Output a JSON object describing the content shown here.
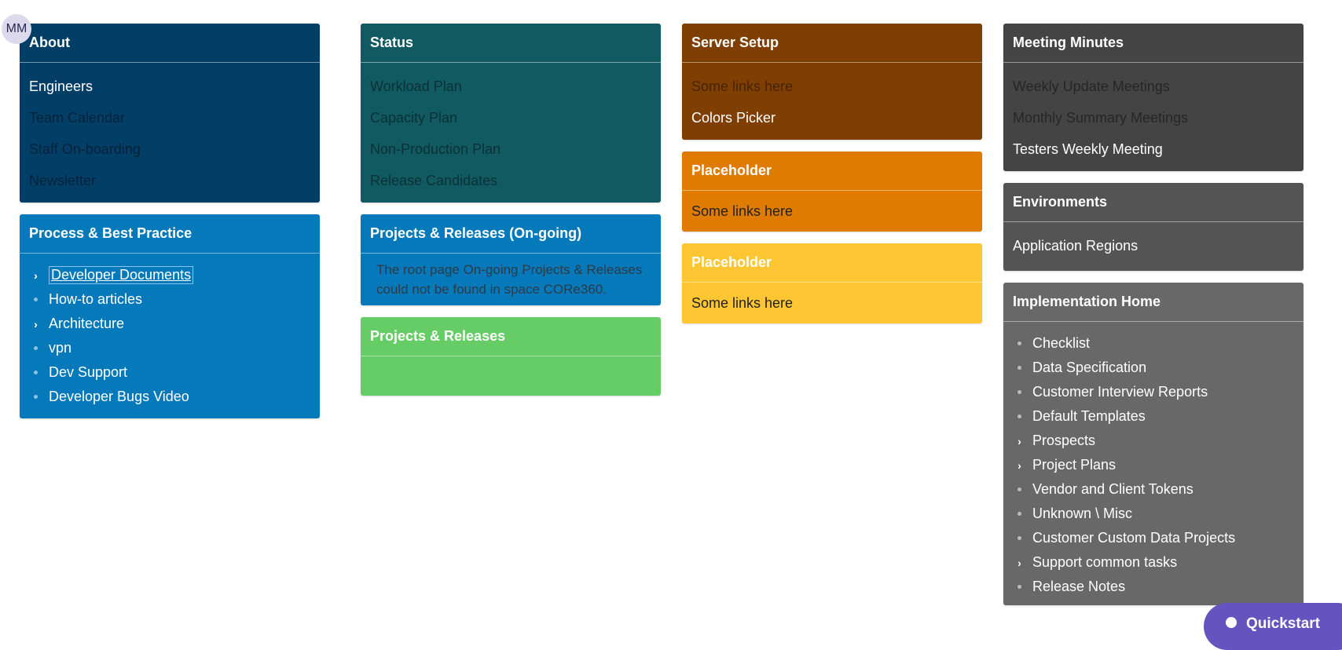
{
  "avatar": "MM",
  "about": {
    "title": "About",
    "links": [
      "Engineers",
      "Team Calendar",
      "Staff On-boarding",
      "Newsletter"
    ]
  },
  "process": {
    "title": "Process & Best Practice",
    "items": [
      {
        "label": "Developer Documents",
        "expandable": true
      },
      {
        "label": "How-to articles",
        "expandable": false
      },
      {
        "label": "Architecture",
        "expandable": true
      },
      {
        "label": "vpn",
        "expandable": false
      },
      {
        "label": "Dev Support",
        "expandable": false
      },
      {
        "label": "Developer Bugs Video",
        "expandable": false
      }
    ]
  },
  "status": {
    "title": "Status",
    "links": [
      "Workload Plan",
      "Capacity Plan",
      "Non-Production Plan",
      "Release Candidates"
    ]
  },
  "projects_ongoing": {
    "title": "Projects & Releases (On-going)",
    "message": "The root page On-going Projects & Releases could not be found in space CORe360."
  },
  "projects_releases": {
    "title": "Projects & Releases"
  },
  "server_setup": {
    "title": "Server Setup",
    "links": [
      "Some links here",
      "Colors Picker"
    ]
  },
  "placeholder1": {
    "title": "Placeholder",
    "links": [
      "Some links here"
    ]
  },
  "placeholder2": {
    "title": "Placeholder",
    "links": [
      "Some links here"
    ]
  },
  "meeting_minutes": {
    "title": "Meeting Minutes",
    "links": [
      "Weekly Update Meetings",
      "Monthly Summary Meetings",
      "Testers Weekly Meeting"
    ]
  },
  "environments": {
    "title": "Environments",
    "links": [
      "Application Regions"
    ]
  },
  "implementation": {
    "title": "Implementation Home",
    "items": [
      {
        "label": "Checklist",
        "expandable": false
      },
      {
        "label": "Data Specification",
        "expandable": false
      },
      {
        "label": "Customer Interview Reports",
        "expandable": false
      },
      {
        "label": "Default Templates",
        "expandable": false
      },
      {
        "label": "Prospects",
        "expandable": true
      },
      {
        "label": "Project Plans",
        "expandable": true
      },
      {
        "label": "Vendor and Client Tokens",
        "expandable": false
      },
      {
        "label": "Unknown \\ Misc",
        "expandable": false
      },
      {
        "label": "Customer Custom Data Projects",
        "expandable": false
      },
      {
        "label": "Support common tasks",
        "expandable": true
      },
      {
        "label": "Release Notes",
        "expandable": false
      }
    ]
  },
  "quickstart": {
    "label": "Quickstart"
  },
  "colors": {
    "about": "#033e66",
    "status": "#125a62",
    "server_setup": "#7f3f02",
    "placeholder_orange": "#e07b02",
    "placeholder_yellow": "#fdc632",
    "meeting_minutes": "#444444",
    "environments": "#545454",
    "implementation": "#686868",
    "process": "#0579ba",
    "projects_ongoing": "#0579ba",
    "projects_releases": "#66cc66",
    "quickstart": "#6554c0"
  }
}
